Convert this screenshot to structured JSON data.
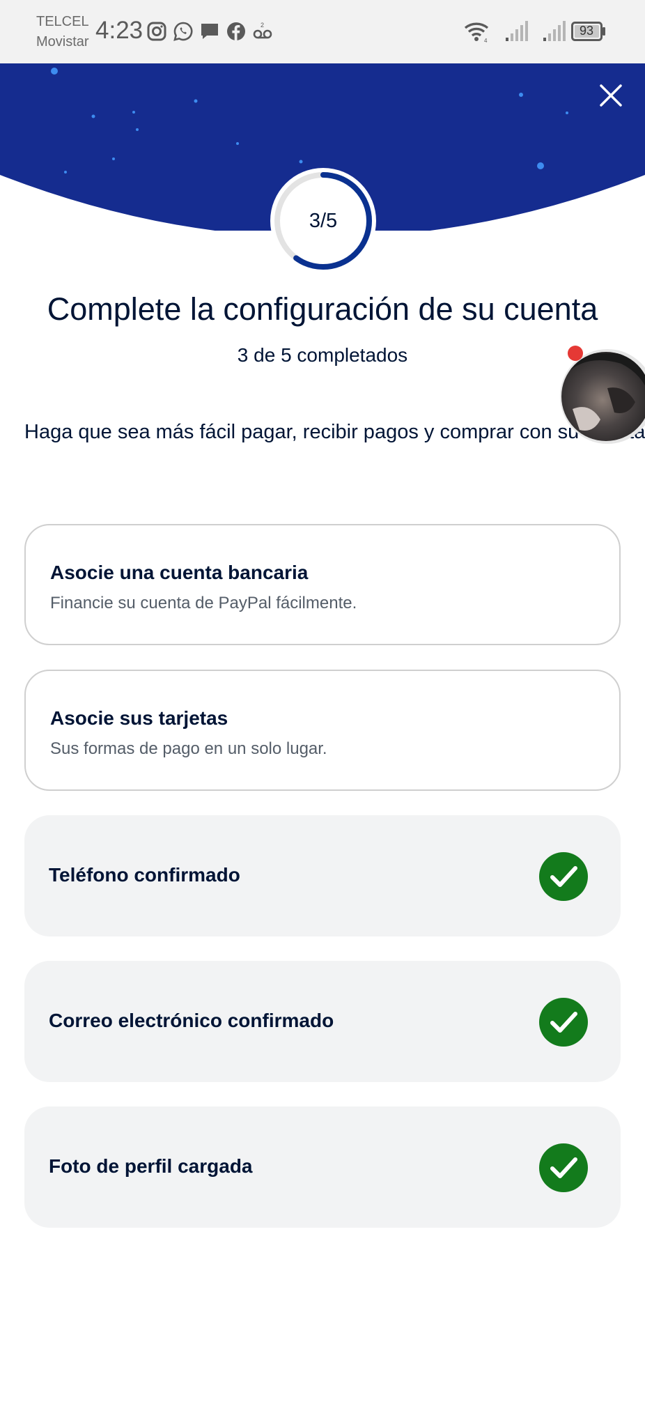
{
  "status_bar": {
    "carrier_1": "TELCEL",
    "carrier_2": "Movistar",
    "time": "4:23",
    "battery": "93",
    "left_icons": [
      "instagram-icon",
      "whatsapp-icon",
      "message-icon",
      "facebook-icon",
      "voicemail-icon"
    ],
    "right_icons": [
      "wifi-icon",
      "signal-icon",
      "signal-icon",
      "battery-icon"
    ]
  },
  "progress": {
    "label": "3/5",
    "completed": 3,
    "total": 5
  },
  "title": "Complete la configuración de su cuenta",
  "subtitle": "3 de 5 completados",
  "description": "Haga que sea más fácil pagar, recibir pagos y comprar con su cuenta.",
  "tasks": [
    {
      "title": "Asocie una cuenta bancaria",
      "subtitle": "Financie su cuenta de PayPal fácilmente.",
      "done": false
    },
    {
      "title": "Asocie sus tarjetas",
      "subtitle": "Sus formas de pago en un solo lugar.",
      "done": false
    },
    {
      "title": "Teléfono confirmado",
      "done": true
    },
    {
      "title": "Correo electrónico confirmado",
      "done": true
    },
    {
      "title": "Foto de perfil cargada",
      "done": true
    }
  ],
  "colors": {
    "header_blue": "#152c8f",
    "ring_blue": "#0a3190",
    "check_green": "#137b1c",
    "text_dark": "#001435"
  }
}
